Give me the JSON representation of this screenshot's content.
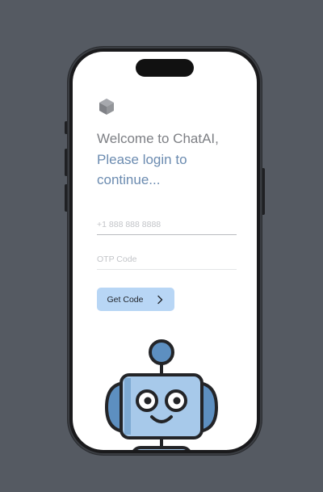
{
  "welcome_text": "Welcome to ChatAI,",
  "prompt_text": "Please login to continue...",
  "phone_field": {
    "placeholder": "+1 888 888 8888",
    "value": ""
  },
  "otp_field": {
    "placeholder": "OTP Code",
    "value": ""
  },
  "get_code_label": "Get Code",
  "icons": {
    "logo": "cube-icon",
    "button": "chevron-right-icon",
    "illustration": "robot-icon"
  },
  "colors": {
    "background": "#555a62",
    "screen": "#ffffff",
    "welcome": "#7d7f84",
    "prompt": "#6b8bb0",
    "button": "#b8d6f5",
    "robot_face": "#a7c9ea",
    "robot_dark": "#5d8fc0"
  }
}
